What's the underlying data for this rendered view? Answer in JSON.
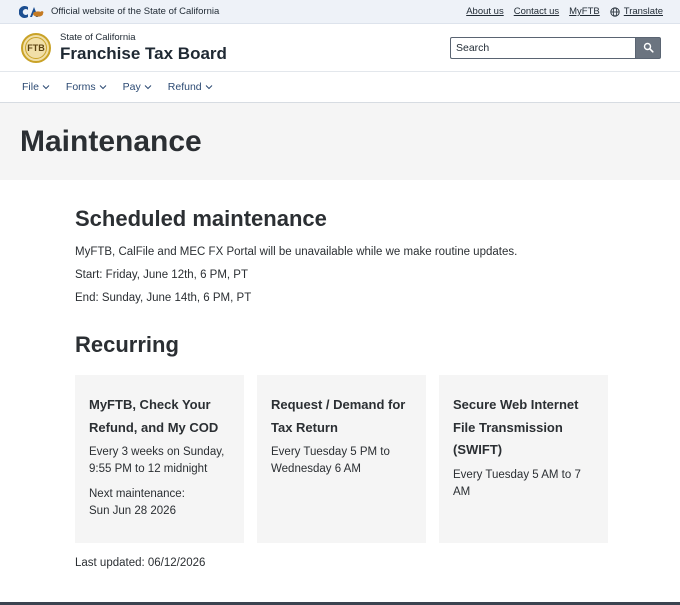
{
  "utility": {
    "official_text": "Official website of the State of California",
    "links": [
      "About us",
      "Contact us",
      "MyFTB"
    ],
    "translate_label": "Translate"
  },
  "header": {
    "seal_text": "FTB",
    "state_label": "State of California",
    "agency_name": "Franchise Tax Board",
    "search_placeholder": "Search"
  },
  "nav": {
    "items": [
      "File",
      "Forms",
      "Pay",
      "Refund"
    ]
  },
  "page": {
    "title": "Maintenance"
  },
  "scheduled": {
    "heading": "Scheduled maintenance",
    "description": "MyFTB, CalFile and MEC FX Portal will be unavailable while we make routine updates.",
    "start": "Start: Friday, June 12th, 6 PM, PT",
    "end": "End: Sunday, June 14th, 6 PM, PT"
  },
  "recurring": {
    "heading": "Recurring",
    "cards": [
      {
        "title_lines": [
          "MyFTB, Check Your",
          "Refund, and My COD"
        ],
        "text_lines": [
          "Every 3 weeks on Sunday,",
          "9:55 PM to 12 midnight"
        ],
        "extra_lines": [
          "Next maintenance:",
          "Sun Jun 28 2026"
        ]
      },
      {
        "title_lines": [
          "Request / Demand for",
          "Tax Return"
        ],
        "text_lines": [
          "Every Tuesday 5 PM to",
          "Wednesday 6 AM"
        ]
      },
      {
        "title_lines": [
          "Secure Web Internet",
          "File Transmission",
          "(SWIFT)"
        ],
        "text_lines": [
          "Every Tuesday 5 AM to 7",
          "AM"
        ]
      }
    ]
  },
  "last_updated": "Last updated: 06/12/2026",
  "colors": {
    "nav_text": "#2c4a73",
    "band_bg": "#f5f5f5",
    "utility_bg": "#eef2f8"
  }
}
